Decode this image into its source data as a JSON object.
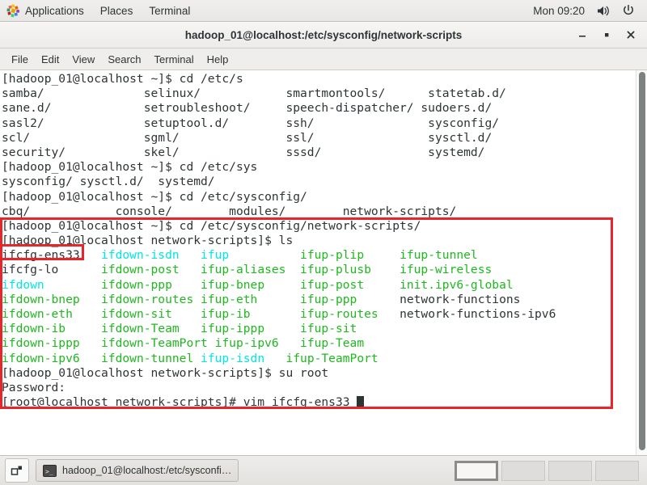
{
  "top_panel": {
    "logo_icon": "gnome-applications-icon",
    "menus": [
      "Applications",
      "Places",
      "Terminal"
    ],
    "clock": "Mon 09:20",
    "volume_icon": "volume-icon",
    "power_icon": "power-icon"
  },
  "window": {
    "title": "hadoop_01@localhost:/etc/sysconfig/network-scripts",
    "minimize_icon": "minimize-icon",
    "maximize_icon": "maximize-icon",
    "close_icon": "close-icon",
    "menubar": [
      "File",
      "Edit",
      "View",
      "Search",
      "Terminal",
      "Help"
    ]
  },
  "terminal": {
    "lines": [
      {
        "segments": [
          {
            "text": "[hadoop_01@localhost ~]$ cd /etc/s",
            "color": "dark"
          }
        ]
      },
      {
        "segments": [
          {
            "text": "samba/              selinux/            smartmontools/      statetab.d/",
            "color": "dark"
          }
        ]
      },
      {
        "segments": [
          {
            "text": "sane.d/             setroubleshoot/     speech-dispatcher/ sudoers.d/",
            "color": "dark"
          }
        ]
      },
      {
        "segments": [
          {
            "text": "sasl2/              setuptool.d/        ssh/                sysconfig/",
            "color": "dark"
          }
        ]
      },
      {
        "segments": [
          {
            "text": "scl/                sgml/               ssl/                sysctl.d/",
            "color": "dark"
          }
        ]
      },
      {
        "segments": [
          {
            "text": "security/           skel/               sssd/               systemd/",
            "color": "dark"
          }
        ]
      },
      {
        "segments": [
          {
            "text": "[hadoop_01@localhost ~]$ cd /etc/sys",
            "color": "dark"
          }
        ]
      },
      {
        "segments": [
          {
            "text": "sysconfig/ sysctl.d/  systemd/",
            "color": "dark"
          }
        ]
      },
      {
        "segments": [
          {
            "text": "[hadoop_01@localhost ~]$ cd /etc/sysconfig/",
            "color": "dark"
          }
        ]
      },
      {
        "segments": [
          {
            "text": "cbq/            console/        modules/        network-scripts/",
            "color": "dark"
          }
        ]
      },
      {
        "segments": [
          {
            "text": "[hadoop_01@localhost ~]$ cd /etc/sysconfig/network-scripts/",
            "color": "dark"
          }
        ]
      },
      {
        "segments": [
          {
            "text": "[hadoop_01@localhost network-scripts]$ ls",
            "color": "dark"
          }
        ]
      },
      {
        "segments": [
          {
            "text": "ifcfg-ens33   ",
            "color": "dark"
          },
          {
            "text": "ifdown-isdn   ",
            "color": "cyan"
          },
          {
            "text": "ifup          ",
            "color": "cyan"
          },
          {
            "text": "ifup-plip     ",
            "color": "green"
          },
          {
            "text": "ifup-tunnel",
            "color": "green"
          }
        ]
      },
      {
        "segments": [
          {
            "text": "ifcfg-lo      ",
            "color": "dark"
          },
          {
            "text": "ifdown-post   ",
            "color": "green"
          },
          {
            "text": "ifup-aliases  ",
            "color": "green"
          },
          {
            "text": "ifup-plusb    ",
            "color": "green"
          },
          {
            "text": "ifup-wireless",
            "color": "green"
          }
        ]
      },
      {
        "segments": [
          {
            "text": "ifdown        ",
            "color": "cyan"
          },
          {
            "text": "ifdown-ppp    ",
            "color": "green"
          },
          {
            "text": "ifup-bnep     ",
            "color": "green"
          },
          {
            "text": "ifup-post     ",
            "color": "green"
          },
          {
            "text": "init.ipv6-global",
            "color": "green"
          }
        ]
      },
      {
        "segments": [
          {
            "text": "ifdown-bnep   ",
            "color": "green"
          },
          {
            "text": "ifdown-routes ",
            "color": "green"
          },
          {
            "text": "ifup-eth      ",
            "color": "green"
          },
          {
            "text": "ifup-ppp      ",
            "color": "green"
          },
          {
            "text": "network-functions",
            "color": "dark"
          }
        ]
      },
      {
        "segments": [
          {
            "text": "ifdown-eth    ",
            "color": "green"
          },
          {
            "text": "ifdown-sit    ",
            "color": "green"
          },
          {
            "text": "ifup-ib       ",
            "color": "green"
          },
          {
            "text": "ifup-routes   ",
            "color": "green"
          },
          {
            "text": "network-functions-ipv6",
            "color": "dark"
          }
        ]
      },
      {
        "segments": [
          {
            "text": "ifdown-ib     ",
            "color": "green"
          },
          {
            "text": "ifdown-Team   ",
            "color": "green"
          },
          {
            "text": "ifup-ippp     ",
            "color": "green"
          },
          {
            "text": "ifup-sit",
            "color": "green"
          }
        ]
      },
      {
        "segments": [
          {
            "text": "ifdown-ippp   ",
            "color": "green"
          },
          {
            "text": "ifdown-TeamPort ",
            "color": "green"
          },
          {
            "text": "ifup-ipv6   ",
            "color": "green"
          },
          {
            "text": "ifup-Team",
            "color": "green"
          }
        ]
      },
      {
        "segments": [
          {
            "text": "ifdown-ipv6   ",
            "color": "green"
          },
          {
            "text": "ifdown-tunnel ",
            "color": "green"
          },
          {
            "text": "ifup-isdn   ",
            "color": "cyan"
          },
          {
            "text": "ifup-TeamPort",
            "color": "green"
          }
        ]
      },
      {
        "segments": [
          {
            "text": "[hadoop_01@localhost network-scripts]$ su root",
            "color": "dark"
          }
        ]
      },
      {
        "segments": [
          {
            "text": "Password:",
            "color": "dark"
          }
        ]
      },
      {
        "segments": [
          {
            "text": "[root@localhost network-scripts]# vim ifcfg-ens33 ",
            "color": "dark"
          },
          {
            "cursor": true
          }
        ]
      }
    ],
    "colors": {
      "background": "#ffffff",
      "foreground": "#2e3436",
      "symlink": "#00e5e5",
      "executable": "#1fb81f",
      "annotation": "#e8252a"
    }
  },
  "annotations": {
    "highlight_filename": "ifcfg-ens33",
    "highlight_region_label": "commands-and-listing-highlight"
  },
  "bottom_panel": {
    "show_desktop_icon": "show-desktop-icon",
    "task_icon": "terminal-icon",
    "task_label": "hadoop_01@localhost:/etc/sysconfi…",
    "workspaces": [
      "1",
      "2",
      "3",
      "4"
    ],
    "active_workspace": 0
  }
}
